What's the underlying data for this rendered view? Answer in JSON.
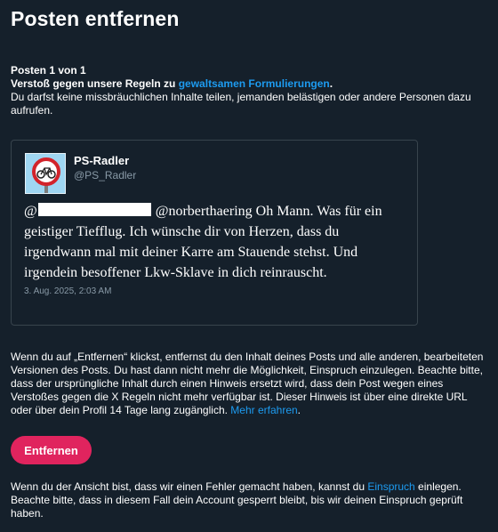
{
  "page": {
    "title": "Posten entfernen",
    "counter": "Posten 1 von 1",
    "violation_prefix": "Verstoß gegen unsere Regeln zu ",
    "violation_link": "gewaltsamen Formulierungen",
    "violation_suffix": ".",
    "rule_description": "Du darfst keine missbräuchlichen Inhalte teilen, jemanden belästigen oder andere Personen dazu aufrufen."
  },
  "tweet": {
    "author_name": "PS-Radler",
    "author_handle": "@PS_Radler",
    "mention_prefix": "@",
    "text": "@norberthaering Oh Mann. Was für ein geistiger Tiefflug. Ich wünsche dir von Herzen, dass du irgendwann mal mit deiner Karre am Stauende stehst. Und irgendein besoffener Lkw-Sklave in dich reinrauscht.",
    "date": "3. Aug. 2025, 2:03 AM"
  },
  "info": {
    "text": "Wenn du auf „Entfernen“ klickst, entfernst du den Inhalt deines Posts und alle anderen, bearbeiteten Versionen des Posts. Du hast dann nicht mehr die Möglichkeit, Einspruch einzulegen. Beachte bitte, dass der ursprüngliche Inhalt durch einen Hinweis ersetzt wird, dass dein Post wegen eines Verstoßes gegen die X Regeln nicht mehr verfügbar ist. Dieser Hinweis ist über eine direkte URL oder über dein Profil 14 Tage lang zugänglich. ",
    "learn_more": "Mehr erfahren",
    "learn_more_suffix": "."
  },
  "remove_button": "Entfernen",
  "appeal": {
    "prefix": "Wenn du der Ansicht bist, dass wir einen Fehler gemacht haben, kannst du ",
    "link": "Einspruch",
    "suffix": " einlegen. Beachte bitte, dass in diesem Fall dein Account gesperrt bleibt, bis wir deinen Einspruch geprüft haben."
  },
  "colors": {
    "background": "#15202b",
    "accent_link": "#1d9bf0",
    "remove_button": "#e0245e",
    "muted": "#8899a6"
  },
  "icons": {
    "avatar": "bicycle-sign-avatar"
  }
}
